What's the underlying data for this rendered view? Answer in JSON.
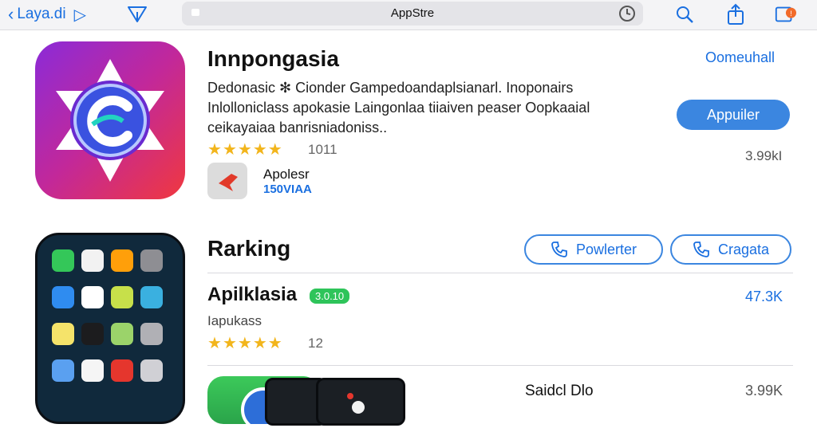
{
  "browser": {
    "back_label": "Laya.di",
    "address_title": "AppStre"
  },
  "featured": {
    "title": "Innpongasia",
    "description": "Dedonasic ✻ Cionder Gampedoandaplsianarl. Inoponairs Inlolloniclass apokasie Laingonlaa tiiaiven peaser Oopkaaial ceikayaiaa banrisniadoniss..",
    "rating_count": "1011",
    "developer_name": "Apolesr",
    "developer_sub": "150VIAA",
    "top_link": "Oomeuhall",
    "action_button": "Appuiler",
    "size": "3.99kI"
  },
  "ranking": {
    "title": "Rarking",
    "button_1": "Powlerter",
    "button_2": "Cragata",
    "item": {
      "title": "Apilklasia",
      "badge": "3.0.10",
      "subtitle": "Iapukass",
      "rating_count": "12",
      "value": "47.3K"
    },
    "bottom": {
      "title": "Saidcl Dlo",
      "value": "3.99K"
    }
  },
  "colors": {
    "accent": "#1a6fe0",
    "button_fill": "#3b86e0",
    "star": "#f2b51c",
    "badge": "#2ec45a"
  },
  "icons": [
    "chevron-left-icon",
    "chevron-right-icon",
    "share-icon",
    "lock-icon",
    "reload-icon",
    "search-icon",
    "share-up-icon",
    "tabs-icon",
    "star-icon",
    "phone-icon"
  ]
}
